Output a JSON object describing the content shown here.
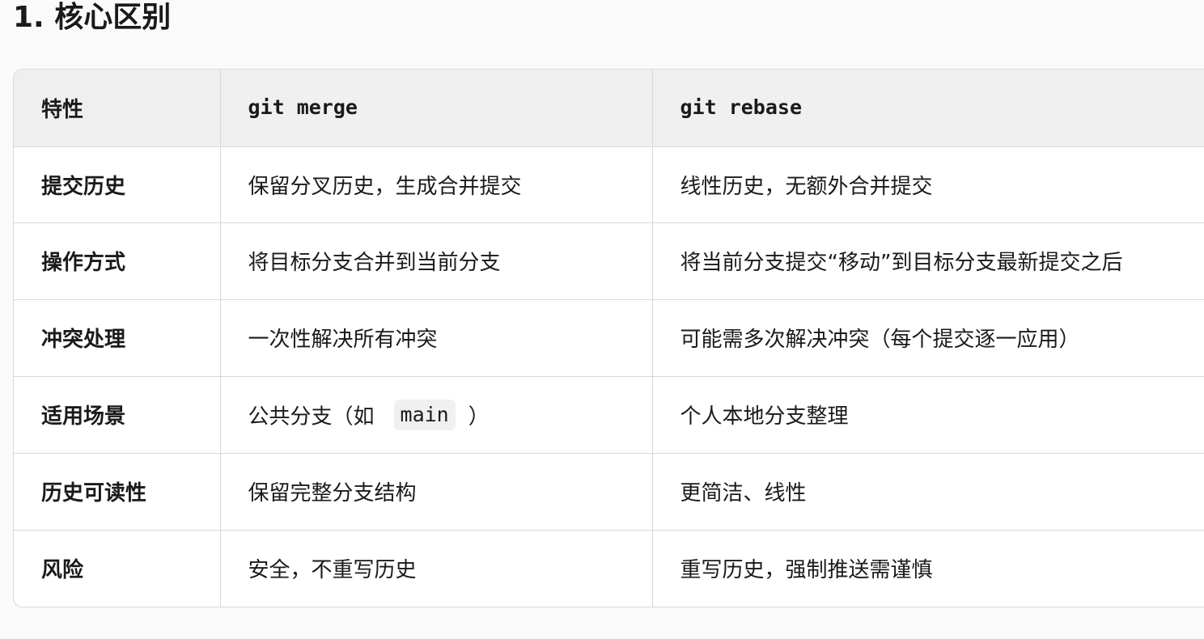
{
  "page": {
    "title": "1. 核心区别"
  },
  "table": {
    "headers": {
      "feature": "特性",
      "merge": "git merge",
      "rebase": "git rebase"
    },
    "rows": [
      {
        "feature": "提交历史",
        "merge": "保留分叉历史，生成合并提交",
        "rebase": "线性历史，无额外合并提交"
      },
      {
        "feature": "操作方式",
        "merge": "将目标分支合并到当前分支",
        "rebase": "将当前分支提交“移动”到目标分支最新提交之后"
      },
      {
        "feature": "冲突处理",
        "merge": "一次性解决所有冲突",
        "rebase": "可能需多次解决冲突（每个提交逐一应用）"
      },
      {
        "feature": "适用场景",
        "merge_prefix": "公共分支（如",
        "merge_code": "main",
        "merge_suffix": "）",
        "rebase": "个人本地分支整理"
      },
      {
        "feature": "历史可读性",
        "merge": "保留完整分支结构",
        "rebase": "更简洁、线性"
      },
      {
        "feature": "风险",
        "merge": "安全，不重写历史",
        "rebase": "重写历史，强制推送需谨慎"
      }
    ]
  }
}
